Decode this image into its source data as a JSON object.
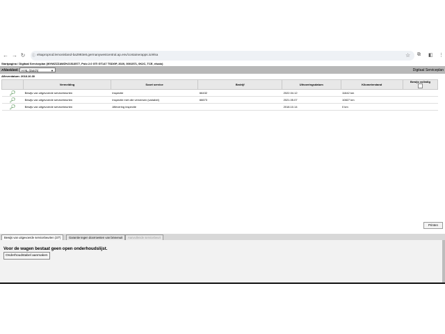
{
  "browser": {
    "url": "elsaproprod.lemonisland-ba2993e8.germanywestcentral.ap.env/containerapps.io/elsa"
  },
  "page": {
    "breadcrumb": "Startpagina / Digitaal Serviceplan (WVWZZZAWZHJ1513577, Polo 2.0 GTI GT147 TSDGP, 2020, 0001571, 0K2C, TCE, elsaio)",
    "afdeling_label": "Afdeeldeel:",
    "selected_option": "H NL (Dutch)",
    "right_title": "Digitaal Serviceplan",
    "date_line": "Afleverdatum: 2018.10.30"
  },
  "table": {
    "headers": [
      "",
      "Vermelding",
      "Soort service",
      "Bedrijf",
      "Uitvoeringsdatum",
      "Kilometerstand",
      "Bewijs volledig"
    ],
    "rows": [
      {
        "vermelding": "Bewijs van uitgevoerde servicebeurten",
        "soort": "Inspectie",
        "bedrijf": "66432",
        "datum": "2022.04.12",
        "km": "11642 km"
      },
      {
        "vermelding": "Bewijs van uitgevoerde servicebeurten",
        "soort": "Inspectie met olie verversen (variabel)",
        "bedrijf": "66673",
        "datum": "2021.05.07",
        "km": "10827 km"
      },
      {
        "vermelding": "Bewijs van uitgevoerde servicebeurten",
        "soort": "Aflevering inspectie",
        "bedrijf": "",
        "datum": "2018.10.14",
        "km": "0 km"
      }
    ]
  },
  "buttons": {
    "print": "Printen",
    "create_plan": "Onderhoudstabel aanmaken"
  },
  "tabs": [
    {
      "label": "Bewijs van uitgevoerde servicebeurten (3/7)"
    },
    {
      "label": "Garantie tegen doorroesten van binnenuit"
    },
    {
      "label": "Aanvullende servicebeurt"
    }
  ],
  "panel": {
    "message": "Voor de wagen bestaat geen open onderhoudslijst."
  }
}
